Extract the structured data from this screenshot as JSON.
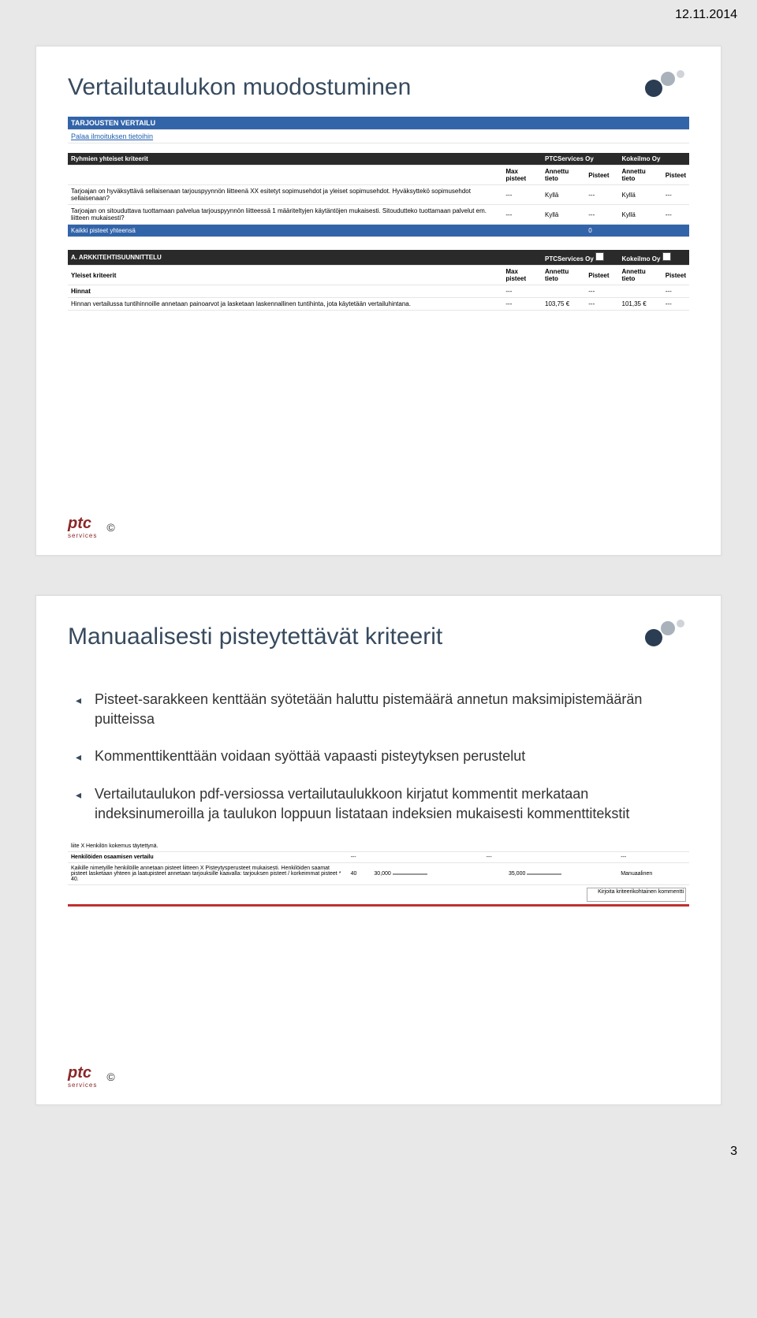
{
  "page_date": "12.11.2014",
  "page_number": "3",
  "slide1": {
    "title": "Vertailutaulukon muodostuminen",
    "hdr1": "TARJOUSTEN VERTAILU",
    "back_link": "Palaa ilmoituksen tietoihin",
    "group_hdr": "Ryhmien yhteiset kriteerit",
    "vendor1": "PTCServices Oy",
    "vendor2": "Kokeilmo Oy",
    "col_max": "Max pisteet",
    "col_annettu": "Annettu tieto",
    "col_pisteet": "Pisteet",
    "crit1": "Tarjoajan on hyväksyttävä sellaisenaan tarjouspyynnön liitteenä XX esitetyt sopimusehdot ja yleiset sopimusehdot. Hyväksyttekö sopimusehdot sellaisenaan?",
    "crit2": "Tarjoajan on sitouduttava tuottamaan palvelua tarjouspyynnön liitteessä 1 määriteltyjen käytäntöjen mukaisesti. Sitoudutteko tuottamaan palvelut em. liitteen mukaisesti?",
    "yes": "Kyllä",
    "total_row": "Kaikki pisteet yhteensä",
    "total_val": "0",
    "section2": "A. ARKKITEHTISUUNNITTELU",
    "yleiset": "Yleiset kriteerit",
    "hinnat": "Hinnat",
    "hinnat_desc": "Hinnan vertailussa tuntihinnoille annetaan painoarvot ja lasketaan laskennallinen tuntihinta, jota käytetään vertailuhintana.",
    "price1": "103,75 €",
    "price2": "101,35 €"
  },
  "slide2": {
    "title": "Manuaalisesti pisteytettävät kriteerit",
    "bullet1": "Pisteet-sarakkeen kenttään syötetään haluttu pistemäärä annetun maksimipistemäärän puitteissa",
    "bullet2": "Kommenttikenttään voidaan syöttää vapaasti pisteytyksen perustelut",
    "bullet3": "Vertailutaulukon pdf-versiossa vertailutaulukkoon kirjatut kommentit merkataan indeksinumeroilla ja taulukon loppuun listataan indeksien mukaisesti kommenttitekstit",
    "row1": "liite X Henkilön kokemus täytettynä.",
    "row_hdr": "Henkilöiden osaamisen vertailu",
    "row2": "Kaikille nimetyille henkilöille annetaan pisteet liitteen X Pisteytysperusteet mukaisesti. Henkilöiden saamat pisteet lasketaan yhteen ja laatupisteet annetaan tarjouksille kaavalla: tarjouksen pisteet / korkeimmat pisteet * 40.",
    "val_max": "40",
    "val_v1": "30,000",
    "val_v2": "35,000",
    "type": "Manuaalinen",
    "input_label": "Kirjoita kriteerikohtainen kommentti"
  },
  "logo": {
    "ptc": "ptc",
    "svc": "services",
    "copy": "©"
  }
}
